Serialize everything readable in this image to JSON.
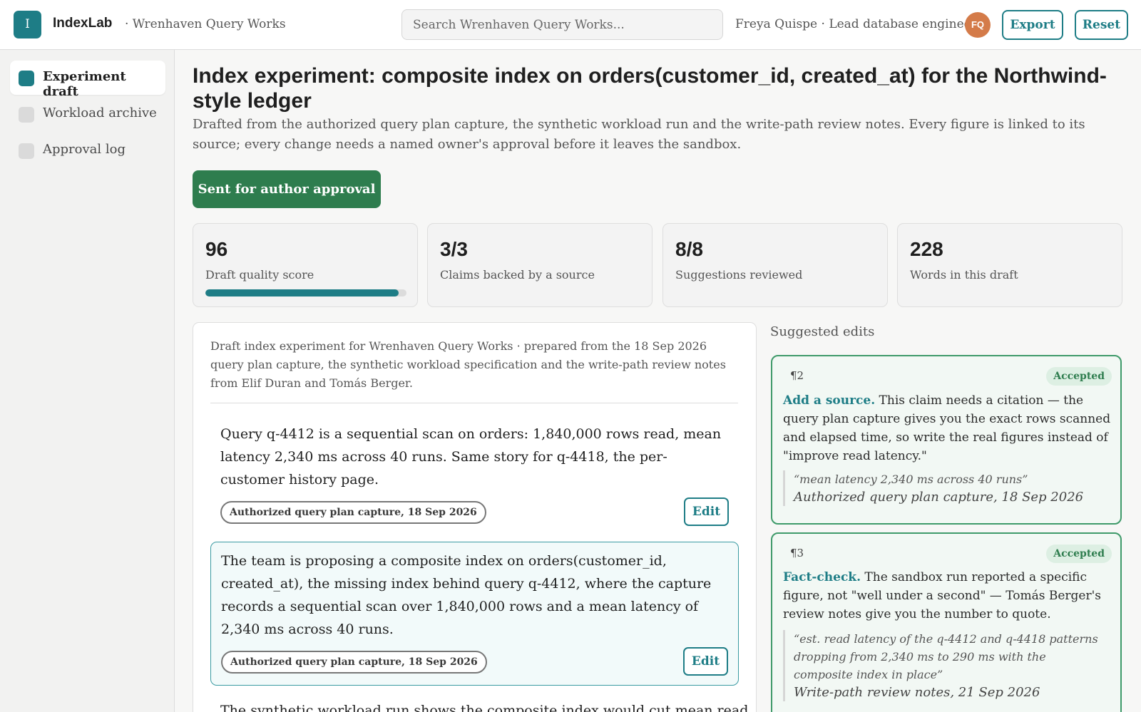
{
  "header": {
    "logo_letter": "I",
    "brand": "IndexLab",
    "workspace": "· Wrenhaven Query Works",
    "search_placeholder": "Search Wrenhaven Query Works...",
    "user": "Freya Quispe · Lead database engineer",
    "avatar_initials": "FQ",
    "export_label": "Export",
    "reset_label": "Reset"
  },
  "sidebar": {
    "items": [
      {
        "label": "Experiment draft",
        "active": true
      },
      {
        "label": "Workload archive",
        "active": false
      },
      {
        "label": "Approval log",
        "active": false
      }
    ]
  },
  "main": {
    "title": "Index experiment: composite index on orders(customer_id, created_at) for the Northwind-style ledger",
    "subtitle": "Drafted from the authorized query plan capture, the synthetic workload run and the write-path review notes. Every figure is linked to its source; every change needs a named owner's approval before it leaves the sandbox.",
    "status_button": "Sent for author approval",
    "stats": [
      {
        "value": "96",
        "label": "Draft quality score",
        "progress": 0.96
      },
      {
        "value": "3/3",
        "label": "Claims backed by a source"
      },
      {
        "value": "8/8",
        "label": "Suggestions reviewed"
      },
      {
        "value": "228",
        "label": "Words in this draft"
      }
    ]
  },
  "draft": {
    "intro": "Draft index experiment for Wrenhaven Query Works · prepared from the 18 Sep 2026 query plan capture, the synthetic workload specification and the write-path review notes from Elif Duran and Tomás Berger.",
    "edit_label": "Edit",
    "paragraphs": [
      {
        "text": "Query q-4412 is a sequential scan on orders: 1,840,000 rows read, mean latency 2,340 ms across 40 runs. Same story for q-4418, the per-customer history page.",
        "source": "Authorized query plan capture, 18 Sep 2026"
      },
      {
        "text": "The team is proposing a composite index on orders(customer_id, created_at), the missing index behind query q-4412, where the capture records a sequential scan over 1,840,000 rows and a mean latency of 2,340 ms across 40 runs.",
        "source": "Authorized query plan capture, 18 Sep 2026"
      },
      {
        "text": "The synthetic workload run shows the composite index would cut mean read"
      }
    ]
  },
  "suggestions": {
    "heading": "Suggested edits",
    "items": [
      {
        "para": "¶2",
        "status": "Accepted",
        "action": "Add a source.",
        "body": " This claim needs a citation — the query plan capture gives you the exact rows scanned and elapsed time, so write the real figures instead of \"improve read latency.\"",
        "quote": "“mean latency 2,340 ms across 40 runs”",
        "quote_source": "Authorized query plan capture, 18 Sep 2026"
      },
      {
        "para": "¶3",
        "status": "Accepted",
        "action": "Fact-check.",
        "body": " The sandbox run reported a specific figure, not \"well under a second\" — Tomás Berger's review notes give you the number to quote.",
        "quote": "“est. read latency of the q-4412 and q-4418 patterns dropping from 2,340 ms to 290 ms with the composite index in place”",
        "quote_source": "Write-path review notes, 21 Sep 2026"
      }
    ]
  },
  "colors": {
    "accent": "#1e7d86",
    "approve": "#2e7d4e",
    "avatar": "#d47b49"
  }
}
